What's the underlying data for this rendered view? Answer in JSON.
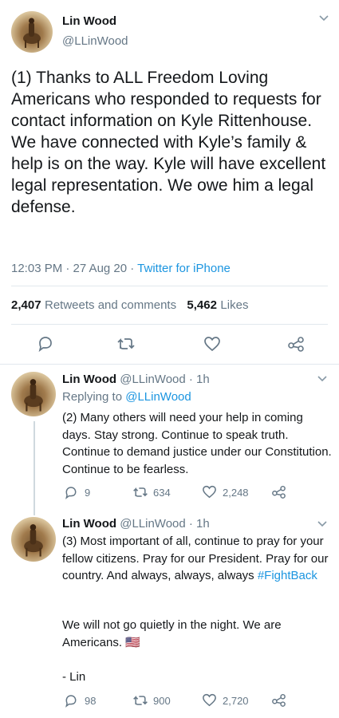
{
  "main_tweet": {
    "author_name": "Lin Wood",
    "author_handle": "@LLinWood",
    "text": "(1) Thanks to ALL Freedom Loving Americans who responded to requests for contact information on Kyle Rittenhouse. We have connected with Kyle’s family & help is on the way. Kyle will have excellent legal representation. We owe him a legal defense.",
    "time": "12:03 PM · 27 Aug 20 · ",
    "source": "Twitter for iPhone",
    "retweets_count": "2,407",
    "retweets_label": "Retweets and comments",
    "likes_count": "5,462",
    "likes_label": "Likes"
  },
  "replies": [
    {
      "author_name": "Lin Wood",
      "author_handle": "@LLinWood · 1h",
      "replying_label": "Replying to ",
      "replying_handle": "@LLinWood",
      "text": "(2) Many others will need your help in coming days. Stay strong. Continue to speak truth. Continue to demand justice under our Constitution. Continue to be fearless.",
      "reply_count": "9",
      "retweet_count": "634",
      "like_count": "2,248"
    },
    {
      "author_name": "Lin Wood",
      "author_handle": "@LLinWood · 1h",
      "text_part1": "(3) Most important of all, continue to pray for your fellow citizens. Pray for our President. Pray for our country. And always, always, always ",
      "hashtag": "#FightBack",
      "text_part2": "We will not go quietly in the night. We are Americans. 🇺🇸",
      "text_part3": "- Lin",
      "reply_count": "98",
      "retweet_count": "900",
      "like_count": "2,720"
    }
  ],
  "icons": {
    "chevron": "chevron-down-icon",
    "reply": "reply-icon",
    "retweet": "retweet-icon",
    "like": "heart-icon",
    "share": "share-icon"
  },
  "colors": {
    "link": "#1b95e0",
    "secondary": "#657786",
    "divider": "#e1e8ed"
  }
}
